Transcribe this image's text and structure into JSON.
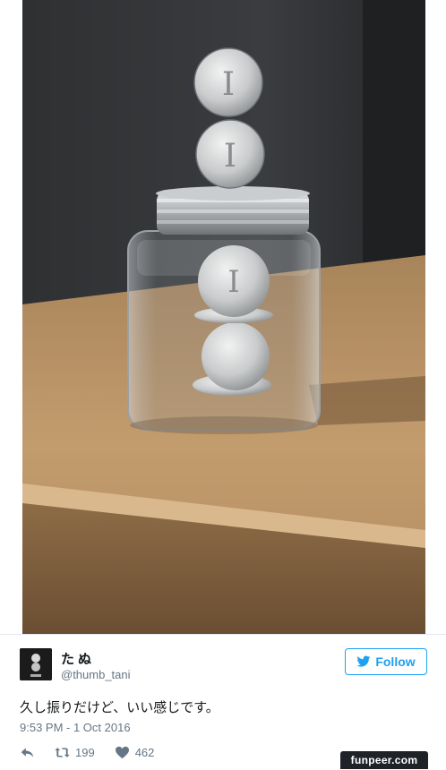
{
  "tweet": {
    "display_name": "たぬ",
    "handle": "@thumb_tani",
    "follow_label": "Follow",
    "text": "久し振りだけど、いい感じです。",
    "timestamp": "9:53 PM - 1 Oct 2016",
    "retweet_count": "199",
    "like_count": "462"
  },
  "watermark": "funpeer.com",
  "icons": {
    "twitter_bird": "twitter-bird-icon",
    "reply": "reply-icon",
    "retweet": "retweet-icon",
    "like": "heart-icon"
  },
  "colors": {
    "accent": "#1da1f2",
    "text": "#14171a",
    "muted": "#657786"
  }
}
